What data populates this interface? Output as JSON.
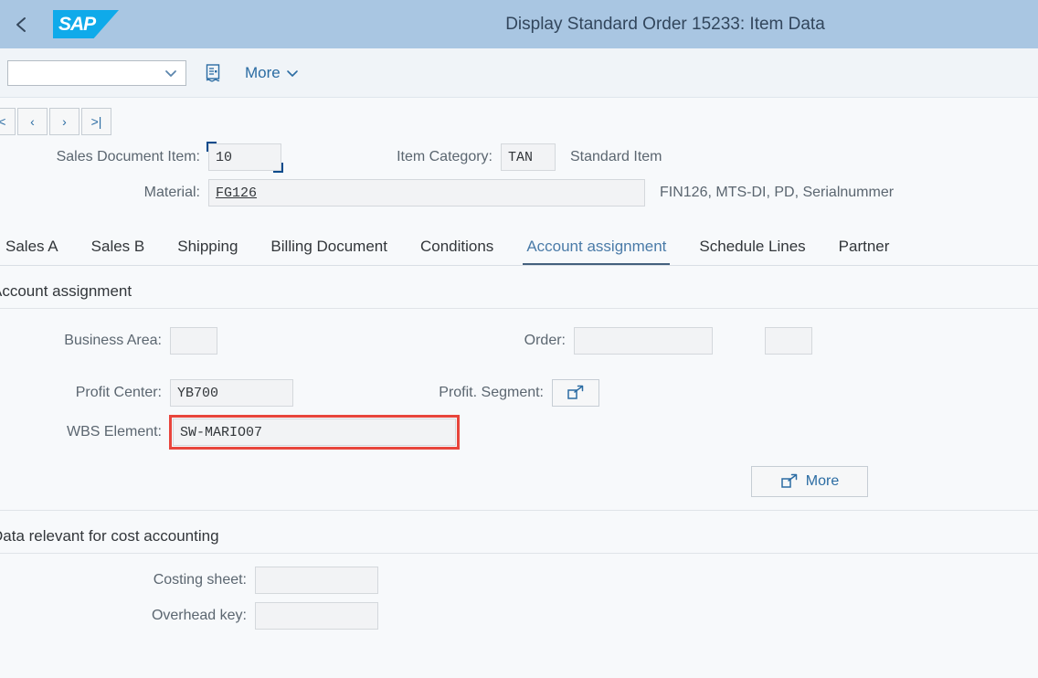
{
  "shell": {
    "back_icon": "chevron-left-icon",
    "logo_text": "SAP",
    "title": "Display Standard Order 15233: Item Data"
  },
  "toolbar": {
    "combo_value": "",
    "combo_placeholder": "",
    "doc_icon": "document-icon",
    "more_label": "More",
    "more_chevron": "chevron-down-icon"
  },
  "nav_buttons": [
    {
      "name": "first-record-button",
      "label": "|<"
    },
    {
      "name": "previous-record-button",
      "label": "‹"
    },
    {
      "name": "next-record-button",
      "label": "›"
    },
    {
      "name": "last-record-button",
      "label": ">|"
    }
  ],
  "header_form": {
    "sales_document_item_label": "Sales Document Item:",
    "sales_document_item_value": "10",
    "item_category_label": "Item Category:",
    "item_category_value": "TAN",
    "item_category_desc": "Standard Item",
    "material_label": "Material:",
    "material_value": "FG126",
    "material_desc": "FIN126, MTS-DI, PD, Serialnummer"
  },
  "tabs": [
    {
      "label": "Sales A",
      "active": false
    },
    {
      "label": "Sales B",
      "active": false
    },
    {
      "label": "Shipping",
      "active": false
    },
    {
      "label": "Billing Document",
      "active": false
    },
    {
      "label": "Conditions",
      "active": false
    },
    {
      "label": "Account assignment",
      "active": true
    },
    {
      "label": "Schedule Lines",
      "active": false
    },
    {
      "label": "Partner",
      "active": false
    }
  ],
  "account_assignment": {
    "section_title": "Account assignment",
    "business_area_label": "Business Area:",
    "business_area_value": "",
    "profit_center_label": "Profit Center:",
    "profit_center_value": "YB700",
    "wbs_element_label": "WBS Element:",
    "wbs_element_value": "SW-MARIO07",
    "wbs_highlight_color": "#e8453c",
    "order_label": "Order:",
    "order_value": "",
    "order_extra_value": "",
    "profit_segment_label": "Profit. Segment:",
    "profit_segment_icon": "open-in-new-icon",
    "more_button_label": "More",
    "more_button_icon": "open-in-new-icon"
  },
  "cost_accounting": {
    "section_title": "Data relevant for cost accounting",
    "costing_sheet_label": "Costing sheet:",
    "costing_sheet_value": "",
    "overhead_key_label": "Overhead key:",
    "overhead_key_value": ""
  },
  "colors": {
    "header_blue": "#a9c6e2",
    "logo_blue": "#0faaea",
    "accent_link": "#2b6ca3",
    "active_tab": "#4a7ba8",
    "highlight_red": "#e8453c",
    "page_bg": "#f7f9fb"
  }
}
